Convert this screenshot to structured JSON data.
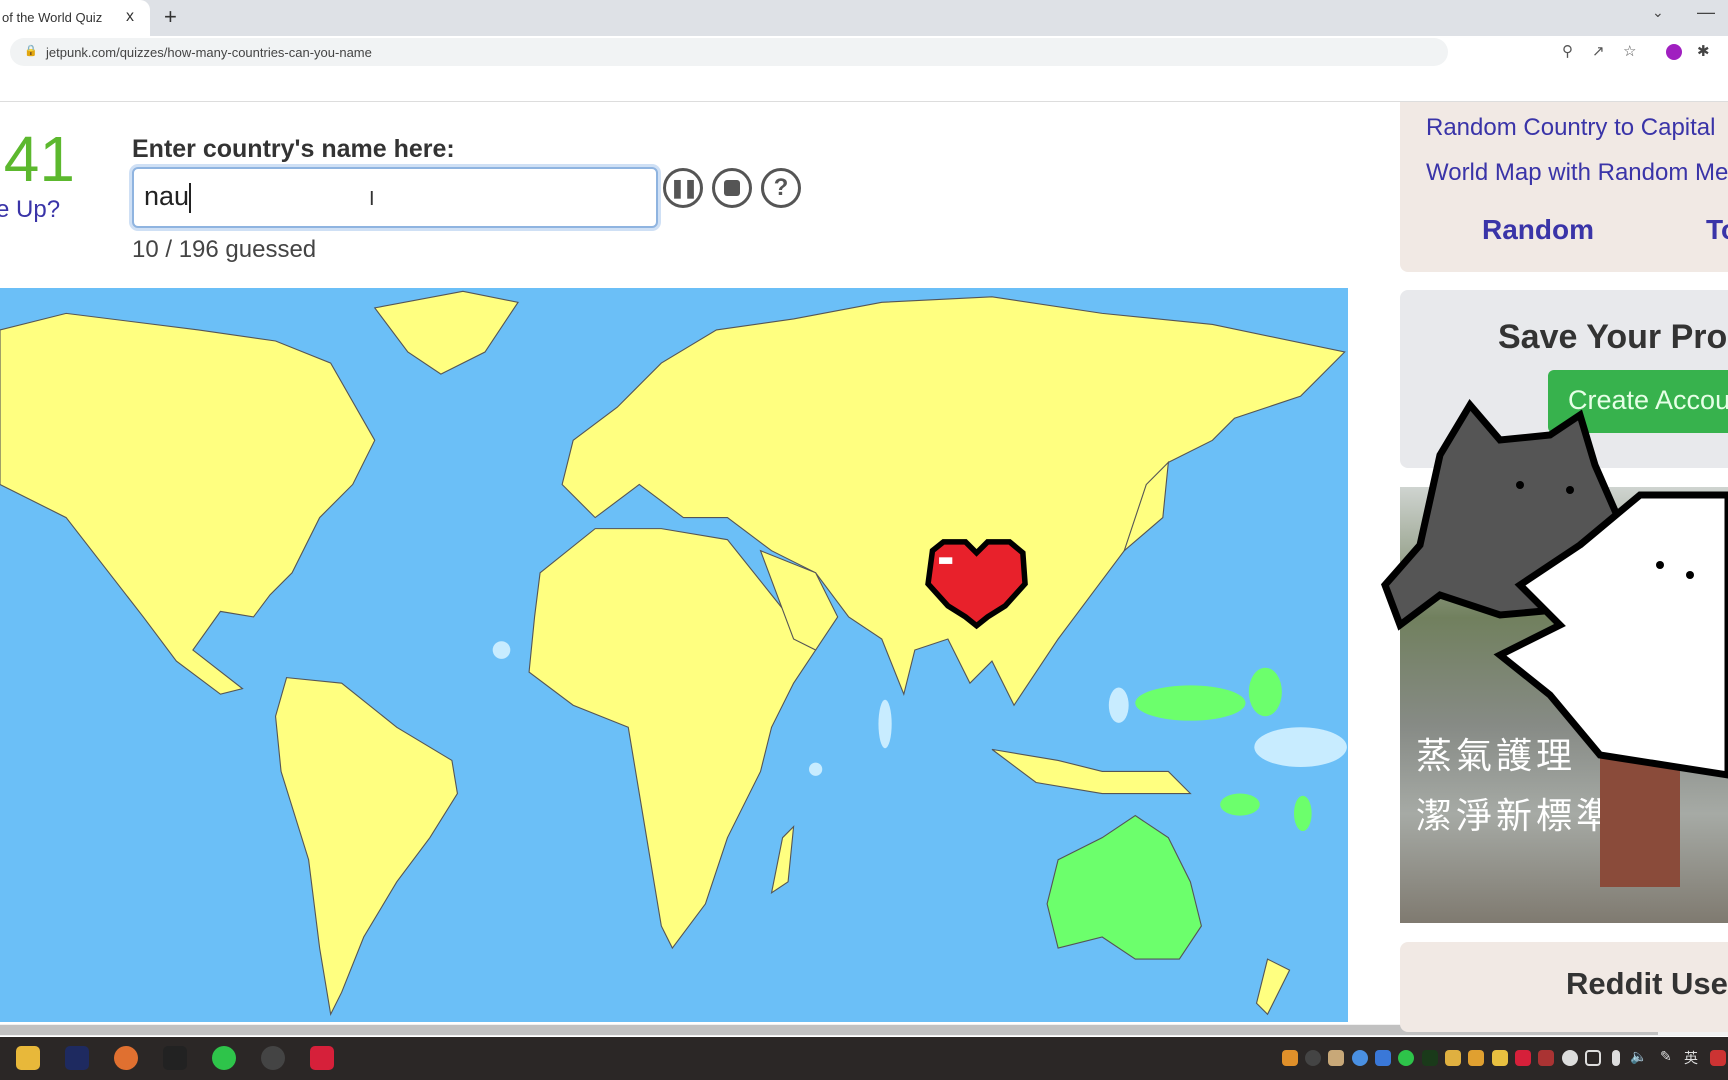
{
  "browser": {
    "tab_title": "of the World Quiz",
    "tab_close": "x",
    "new_tab": "+",
    "url": "jetpunk.com/quizzes/how-many-countries-can-you-name",
    "icons": [
      "lock-icon",
      "zoom-icon",
      "share-icon",
      "star-icon",
      "profile-icon",
      "extensions-icon"
    ]
  },
  "quiz": {
    "timer": ":41",
    "give_up": "e Up?",
    "prompt": "Enter country's name here:",
    "input_value": "nau",
    "pause_icon": "pause-icon",
    "stop_icon": "stop-icon",
    "help_label": "?",
    "guessed": "10 / 196 guessed"
  },
  "map": {
    "ocean_color": "#6bbff7",
    "land_color": "#ffff80",
    "guessed_color": "#6cff6c",
    "overlay_icon": "pixel-heart-icon"
  },
  "sidebar": {
    "links": [
      "Random Country to Capital",
      "World Map with Random Me"
    ],
    "nav": [
      "Random",
      "To"
    ],
    "save_title": "Save Your Pro",
    "create_button": "Create Accou",
    "ad_lines": [
      "蒸氣護理",
      "潔淨新標準"
    ],
    "reddit_title": "Reddit Use"
  },
  "overlay": {
    "sticker": "cat-sticker"
  },
  "taskbar": {
    "ime": "英"
  }
}
